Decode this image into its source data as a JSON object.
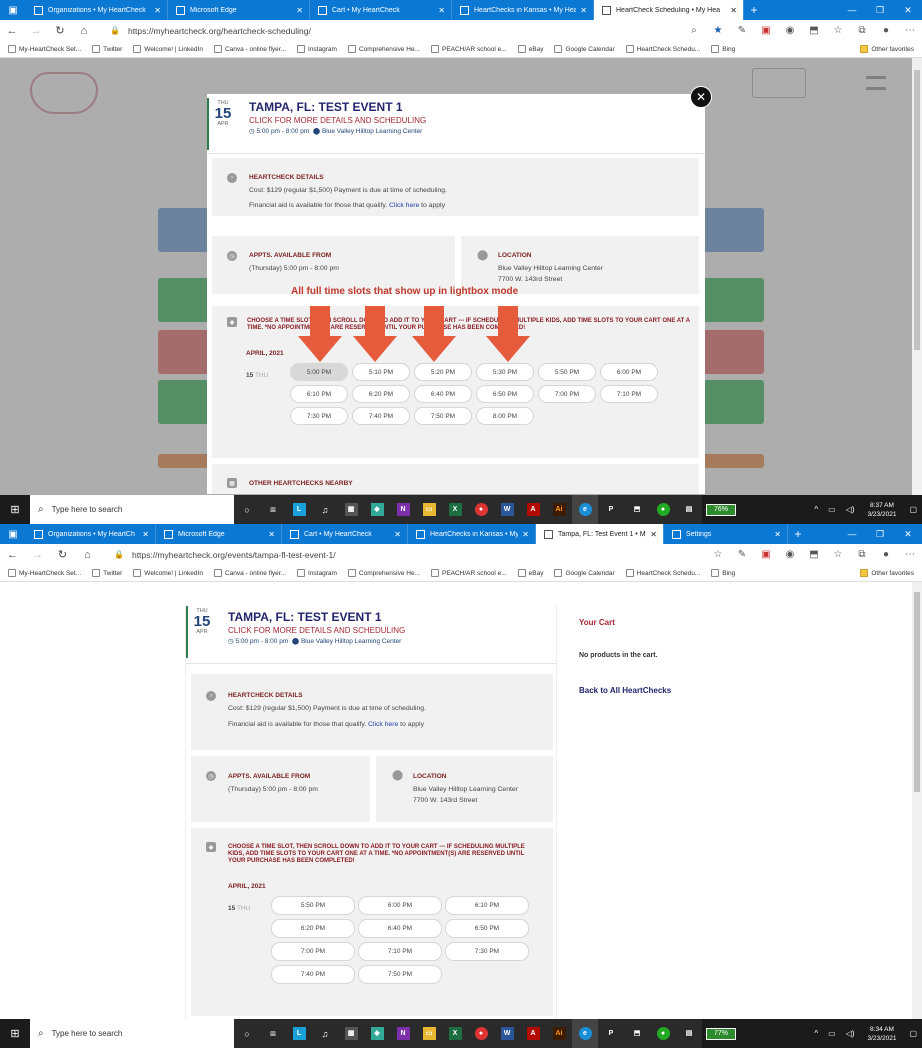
{
  "top": {
    "tabs": [
      "Organizations • My HeartCheck",
      "Microsoft Edge",
      "Cart • My HeartCheck",
      "HeartChecks in Kansas • My Hea",
      "HeartCheck Scheduling • My Hea"
    ],
    "url": "https://myheartcheck.org/heartcheck-scheduling/",
    "time": "8:37 AM",
    "date": "3/23/2021",
    "battery": "76%"
  },
  "bottom": {
    "tabs": [
      "Organizations • My HeartCh",
      "Microsoft Edge",
      "Cart • My HeartCheck",
      "HeartChecks in Kansas • My",
      "Tampa, FL: Test Event 1 • My",
      "Settings"
    ],
    "url": "https://myheartcheck.org/events/tampa-fl-test-event-1/",
    "time": "8:34 AM",
    "date": "3/23/2021",
    "battery": "77%"
  },
  "bookmarks": [
    "My-HeartCheck Set...",
    "Twitter",
    "Welcome! | LinkedIn",
    "Canva - online flyer...",
    "Instagram",
    "Comprehensive He...",
    "PEACH/AR school e...",
    "eBay",
    "Google Calendar",
    "HeartCheck Schedu...",
    "Bing"
  ],
  "other_favorites": "Other favorites",
  "taskbar_search": "Type here to search",
  "event": {
    "dow": "THU",
    "day": "15",
    "month": "APR",
    "title": "TAMPA, FL: TEST EVENT 1",
    "subtitle": "CLICK FOR MORE DETAILS AND SCHEDULING",
    "time_range": "5:00 pm - 8:00 pm",
    "venue": "Blue Valley Hilltop Learning Center",
    "details_head": "HEARTCHECK DETAILS",
    "cost": "Cost: $129 (regular $1,500)  Payment is due at time of scheduling.",
    "aid_pre": "Financial aid is available for those that qualify.",
    "aid_link": "Click here",
    "aid_post": "to apply",
    "appts_head": "APPTS. AVAILABLE FROM",
    "appts_text": "(Thursday) 5:00 pm - 8:00 pm",
    "loc_head": "LOCATION",
    "loc_line1": "Blue Valley Hilltop Learning Center",
    "loc_line2": "7700 W. 143rd Street",
    "choose": "CHOOSE A TIME SLOT, THEN SCROLL DOWN TO ADD IT TO YOUR CART --- IF SCHEDULING MULTIPLE KIDS, ADD TIME SLOTS TO YOUR CART ONE AT A TIME. *NO APPOINTMENT(S) ARE RESERVED UNTIL YOUR PURCHASE HAS BEEN COMPLETED!",
    "month_label": "APRIL, 2021",
    "row_day": "15",
    "row_dow": "THU",
    "nearby": "OTHER HEARTCHECKS NEARBY"
  },
  "slots_top": [
    "5:00 PM",
    "5:10 PM",
    "5:20 PM",
    "5:30 PM",
    "5:50 PM",
    "6:00 PM",
    "6:10 PM",
    "6:20 PM",
    "6:40 PM",
    "6:50 PM",
    "7:00 PM",
    "7:10 PM",
    "7:30 PM",
    "7:40 PM",
    "7:50 PM",
    "8:00 PM"
  ],
  "slots_bottom": [
    "5:50 PM",
    "6:00 PM",
    "6:10 PM",
    "6:20 PM",
    "6:40 PM",
    "6:50 PM",
    "7:00 PM",
    "7:10 PM",
    "7:30 PM",
    "7:40 PM",
    "7:50 PM"
  ],
  "annotation": "All full time slots that show up in lightbox mode",
  "cart": {
    "title": "Your Cart",
    "empty": "No products in the cart.",
    "back": "Back to All HeartChecks"
  },
  "colors": {
    "arrow": "#e55b3c",
    "title": "#23256e",
    "accent": "#a52833"
  }
}
